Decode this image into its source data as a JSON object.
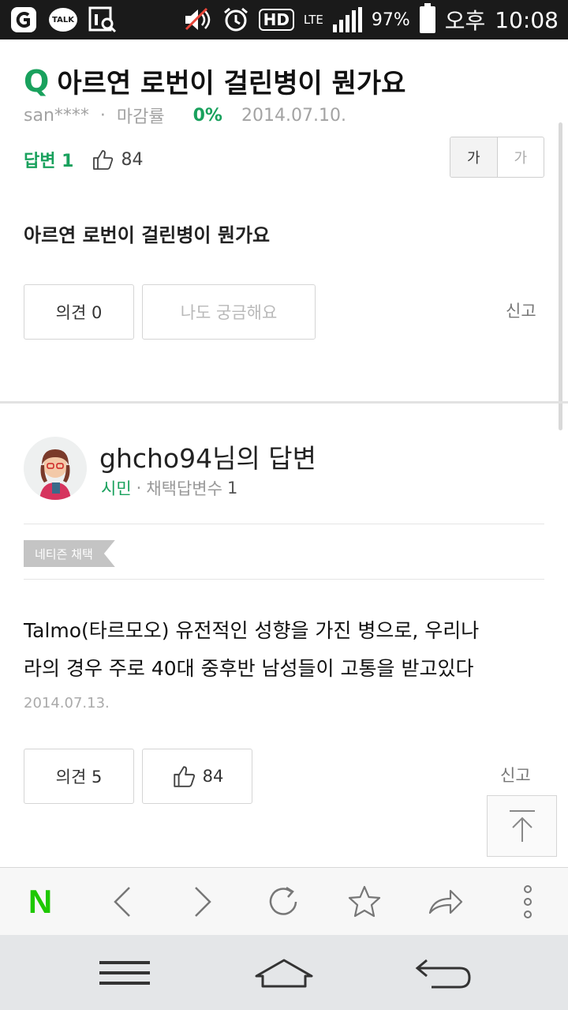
{
  "status_bar": {
    "talk_label": "TALK",
    "hd_label": "HD",
    "lte_label": "LTE",
    "battery": "97%",
    "ampm": "오후",
    "time": "10:08"
  },
  "question": {
    "mark": "Q",
    "title": "아르연 로번이 걸린병이 뭔가요",
    "author": "san****",
    "close_rate_label": "마감률",
    "close_rate": "0%",
    "date": "2014.07.10.",
    "answer_label": "답변",
    "answer_count": "1",
    "like_count": "84",
    "body": "아르연 로번이 걸린병이 뭔가요",
    "comment_button": "의견 0",
    "curious_button": "나도 궁금해요",
    "report": "신고"
  },
  "font_toggle": {
    "large": "가",
    "small": "가"
  },
  "answer": {
    "author_title": "ghcho94님의 답변",
    "rank": "시민",
    "separator": "·",
    "adopted_label": "채택답변수",
    "adopted_count": "1",
    "badge": "네티즌 채택",
    "text_line1": "Talmo(타르모오) 유전적인 성향을 가진 병으로, 우리나",
    "text_line2": "라의 경우 주로 40대 중후반 남성들이 고통을 받고있다",
    "date": "2014.07.13.",
    "comment_button": "의견 5",
    "like_count": "84",
    "report": "신고"
  },
  "browser_toolbar": {
    "logo": "N",
    "icons": [
      "naver-logo",
      "back-icon",
      "forward-icon",
      "refresh-icon",
      "star-icon",
      "share-icon",
      "more-icon"
    ]
  },
  "nav_bar": {
    "icons": [
      "menu-icon",
      "home-icon",
      "back-icon"
    ]
  },
  "colors": {
    "accent_green": "#19a15d",
    "naver_green": "#1ec800",
    "status_bg": "#1a1a1a",
    "nav_bg": "#e4e6e8"
  }
}
